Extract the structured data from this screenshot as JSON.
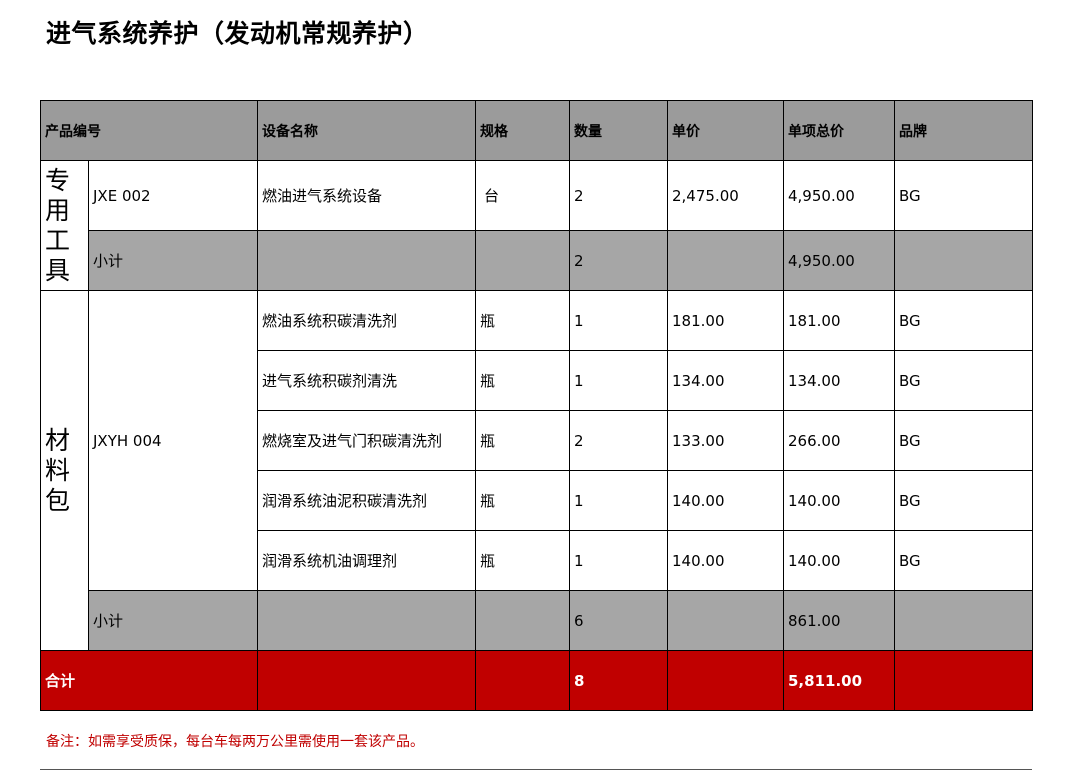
{
  "title": "进气系统养护（发动机常规养护）",
  "headers": {
    "code": "产品编号",
    "name": "设备名称",
    "spec": "规格",
    "qty": "数量",
    "unit_price": "单价",
    "line_total": "单项总价",
    "brand": "品牌"
  },
  "groups": [
    {
      "category": [
        "专",
        "用",
        "工",
        "具"
      ],
      "code": "JXE 002",
      "items": [
        {
          "name": "燃油进气系统设备",
          "spec": "台",
          "qty": "2",
          "unit_price": "2,475.00",
          "line_total": "4,950.00",
          "brand": "BG"
        }
      ],
      "subtotal": {
        "label": "小计",
        "qty": "2",
        "line_total": "4,950.00"
      }
    },
    {
      "category": [
        "材",
        "料",
        "包"
      ],
      "code": "JXYH 004",
      "items": [
        {
          "name": "燃油系统积碳清洗剂",
          "spec": "瓶",
          "qty": "1",
          "unit_price": "181.00",
          "line_total": "181.00",
          "brand": "BG"
        },
        {
          "name": "进气系统积碳剂清洗",
          "spec": "瓶",
          "qty": "1",
          "unit_price": "134.00",
          "line_total": "134.00",
          "brand": "BG"
        },
        {
          "name": "燃烧室及进气门积碳清洗剂",
          "spec": "瓶",
          "qty": "2",
          "unit_price": "133.00",
          "line_total": "266.00",
          "brand": "BG"
        },
        {
          "name": "润滑系统油泥积碳清洗剂",
          "spec": "瓶",
          "qty": "1",
          "unit_price": "140.00",
          "line_total": "140.00",
          "brand": "BG"
        },
        {
          "name": "润滑系统机油调理剂",
          "spec": "瓶",
          "qty": "1",
          "unit_price": "140.00",
          "line_total": "140.00",
          "brand": "BG"
        }
      ],
      "subtotal": {
        "label": "小计",
        "qty": "6",
        "line_total": "861.00"
      }
    }
  ],
  "total": {
    "label": "合计",
    "qty": "8",
    "line_total": "5,811.00"
  },
  "note": "备注：如需享受质保，每台车每两万公里需使用一套该产品。",
  "colors": {
    "header_bg": "#9b9b9b",
    "subtotal_bg": "#a6a6a6",
    "total_bg": "#c00000",
    "note_text": "#c00000"
  }
}
